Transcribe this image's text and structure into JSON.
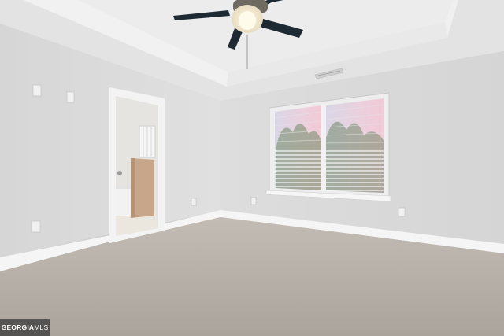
{
  "watermark": {
    "brand": "GEORGIA",
    "suffix": "MLS"
  },
  "colors": {
    "wall": "#dcdcdc",
    "wall_shadow": "#cfcfcf",
    "ceiling": "#e4e4e4",
    "tray_ceiling": "#ececec",
    "carpet": "#b9b3ab",
    "trim": "#f4f4f4",
    "fan_blade": "#1e2a33",
    "window_pane": "#f2f2f4"
  },
  "icons": [
    "ceiling-fan-icon",
    "air-vent-icon",
    "outlet-icon",
    "light-switch-icon"
  ]
}
